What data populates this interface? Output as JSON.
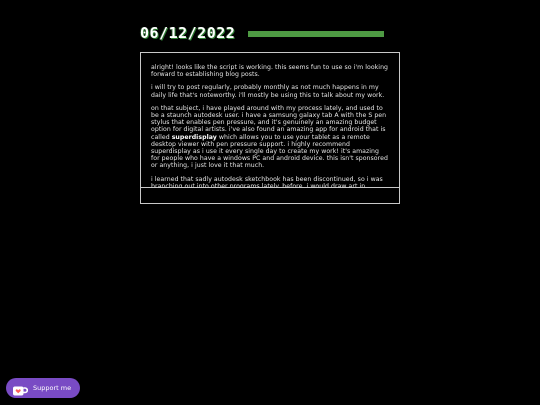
{
  "post": {
    "date": "06/12/2022",
    "paragraphs": [
      {
        "text": "alright! looks like the script is working. this seems fun to use so i'm looking forward to establishing blog posts."
      },
      {
        "text": "i will try to post regularly, probably monthly as not much happens in my daily life that's noteworthy. i'll mostly be using this to talk about my work."
      },
      {
        "before": "on that subject, i have played around with my process lately, and used to be a staunch autodesk user. i have a samsung galaxy tab A with the S pen stylus that enables pen pressure, and it's genuinely an amazing budget option for digital artists. i've also found an amazing app for android that is called ",
        "highlight": "superdisplay",
        "after": " which allows you to use your tablet as a remote desktop viewer with pen pressure support. i highly recommend superdisplay as i use it every single day to create my work! it's amazing for people who have a windows PC and android device. this isn't sponsored or anything, i just love it that much."
      },
      {
        "text": "i learned that sadly autodesk sketchbook has been discontinued, so i was branching out into other programs lately. before, i would draw art in autodesk sketchbook and then open it in ibis paint (a very good mobile art program with"
      }
    ]
  },
  "support_button": {
    "label": "Support me",
    "icon": "ko-fi-cup-icon",
    "color": "#794bc4"
  },
  "colors": {
    "background": "#000000",
    "accent_bar": "#4e9a43",
    "text": "#e6e6e6",
    "border": "#c8c8c8"
  }
}
